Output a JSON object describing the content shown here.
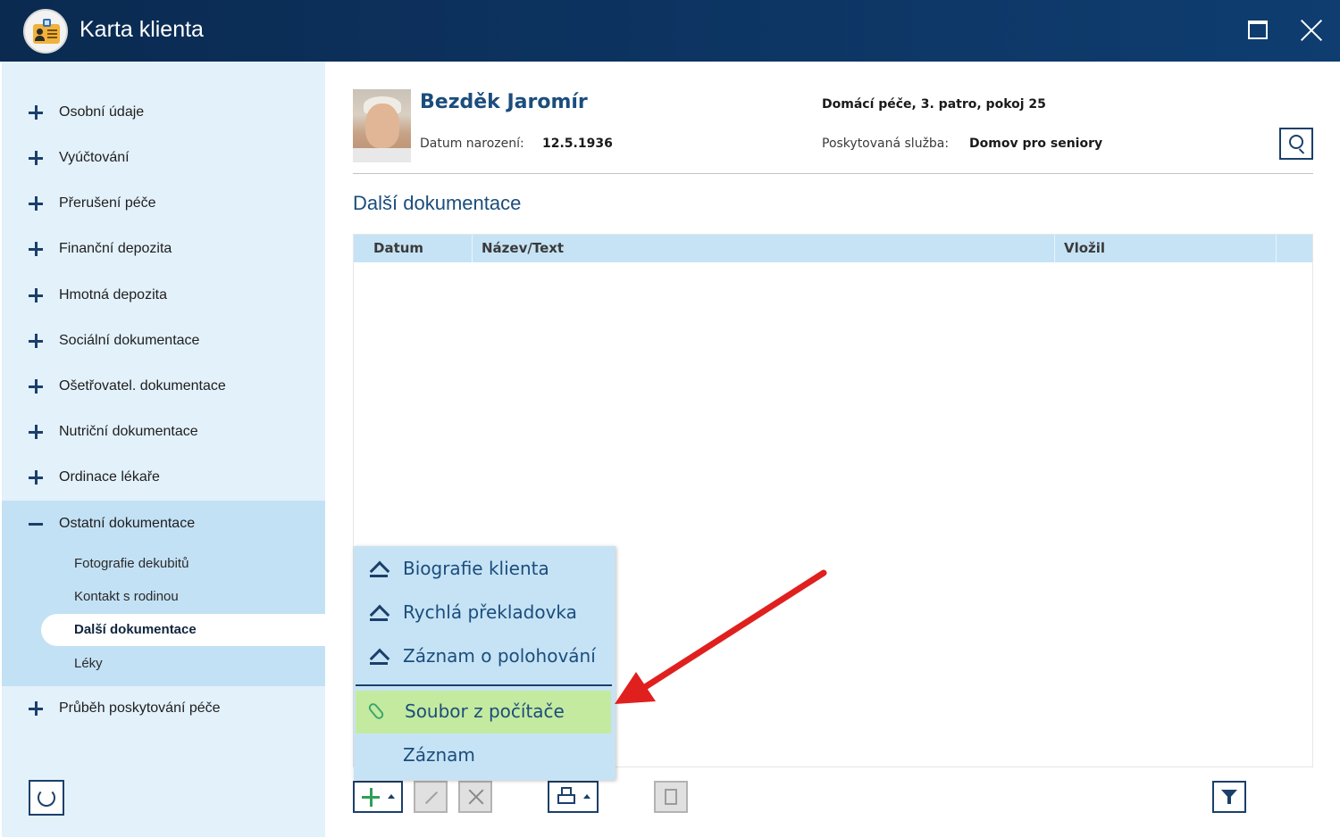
{
  "window": {
    "title": "Karta klienta",
    "icons": {
      "app": "client-card-icon",
      "maximize": "maximize-icon",
      "close": "close-icon"
    }
  },
  "sidebar": {
    "items": [
      {
        "label": "Osobní údaje",
        "state": "collapsed"
      },
      {
        "label": "Vyúčtování",
        "state": "collapsed"
      },
      {
        "label": "Přerušení péče",
        "state": "collapsed"
      },
      {
        "label": "Finanční depozita",
        "state": "collapsed"
      },
      {
        "label": "Hmotná depozita",
        "state": "collapsed"
      },
      {
        "label": "Sociální dokumentace",
        "state": "collapsed"
      },
      {
        "label": "Ošetřovatel. dokumentace",
        "state": "collapsed"
      },
      {
        "label": "Nutriční dokumentace",
        "state": "collapsed"
      },
      {
        "label": "Ordinace lékaře",
        "state": "collapsed"
      },
      {
        "label": "Ostatní dokumentace",
        "state": "expanded"
      },
      {
        "label": "Průběh poskytování péče",
        "state": "collapsed"
      }
    ],
    "subitems": [
      {
        "label": "Fotografie dekubitů",
        "active": false
      },
      {
        "label": "Kontakt s rodinou",
        "active": false
      },
      {
        "label": "Další dokumentace",
        "active": true
      },
      {
        "label": "Léky",
        "active": false
      }
    ],
    "refresh_icon": "refresh-icon"
  },
  "client": {
    "name": "Bezděk Jaromír",
    "birth_label": "Datum narození:",
    "birth_value": "12.5.1936",
    "location": "Domácí péče, 3. patro, pokoj 25",
    "service_label": "Poskytovaná služba:",
    "service_value": "Domov pro seniory"
  },
  "section": {
    "title": "Další dokumentace"
  },
  "table": {
    "columns": [
      "Datum",
      "Název/Text",
      "Vložil"
    ],
    "rows": []
  },
  "popup": {
    "items": [
      {
        "label": "Biografie klienta",
        "icon": "form-icon"
      },
      {
        "label": "Rychlá překladovka",
        "icon": "form-icon"
      },
      {
        "label": "Záznam o polohování",
        "icon": "form-icon"
      },
      {
        "label": "Soubor z počítače",
        "icon": "paperclip-icon",
        "highlighted": true
      },
      {
        "label": "Záznam",
        "icon": ""
      }
    ]
  },
  "colors": {
    "titlebar": "#0d3563",
    "sidebar_bg": "#e3f1fb",
    "accent": "#1b4d7c",
    "highlight": "#c4eaa0",
    "arrow": "#e0201f"
  }
}
